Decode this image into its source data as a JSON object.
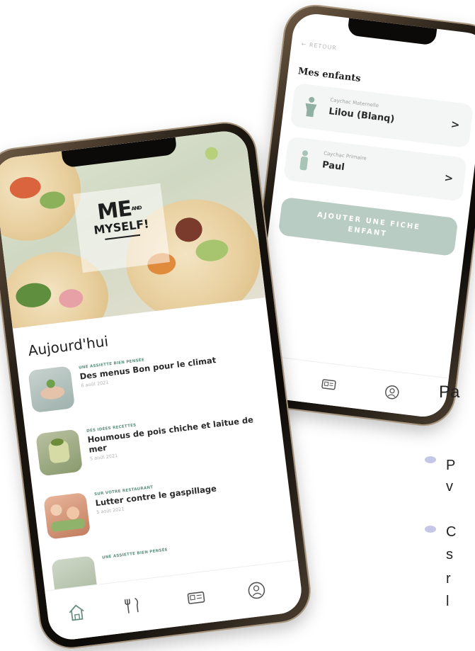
{
  "back_screen": {
    "back_link": "← RETOUR",
    "title": "Mes enfants",
    "children": [
      {
        "school": "Caychac Maternelle",
        "name": "Lilou (Blanq)",
        "chevron": ">"
      },
      {
        "school": "Caychac Primaire",
        "name": "Paul",
        "chevron": ">"
      }
    ],
    "add_button": "AJOUTER UNE FICHE ENFANT",
    "nav": [
      "menu-icon",
      "card-icon",
      "profile-icon"
    ]
  },
  "front_screen": {
    "logo": {
      "main": "ME",
      "and": "AND",
      "sub": "MYSELF!"
    },
    "section_title": "Aujourd'hui",
    "articles": [
      {
        "category": "UNE ASSIETTE BIEN PENSÉE",
        "title": "Des menus Bon pour le climat",
        "date": "6 août 2021"
      },
      {
        "category": "DES IDÉES RECETTES",
        "title": "Houmous de pois chiche et laitue de mer",
        "date": "5 août 2021"
      },
      {
        "category": "SUR VOTRE RESTAURANT",
        "title": "Lutter contre le gaspillage",
        "date": "5 août 2021"
      },
      {
        "category": "UNE ASSIETTE BIEN PENSÉE",
        "title": "",
        "date": ""
      }
    ],
    "nav": [
      "home-icon",
      "menu-icon",
      "card-icon",
      "profile-icon"
    ]
  },
  "side_text": {
    "heading": "Pa",
    "line1a": "P",
    "line1b": "v",
    "line2a": "C",
    "line2b": "s",
    "line2c": "r",
    "line2d": "l"
  },
  "colors": {
    "accent": "#5c8f7c",
    "button": "#b9ccc4",
    "bullet": "#c5c7e6"
  }
}
